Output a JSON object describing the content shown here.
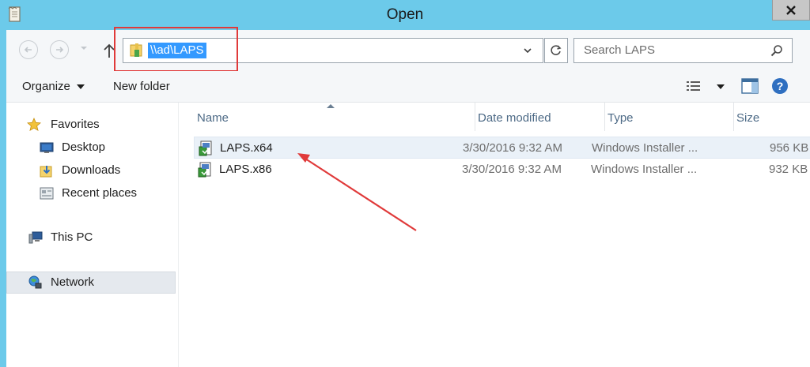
{
  "window": {
    "title": "Open",
    "close_label": "X"
  },
  "address_bar": {
    "path": "\\\\ad\\LAPS"
  },
  "search": {
    "placeholder": "Search LAPS"
  },
  "toolbar": {
    "organize_label": "Organize",
    "new_folder_label": "New folder"
  },
  "sidebar": {
    "items": [
      {
        "label": "Favorites",
        "icon": "star-icon"
      },
      {
        "label": "Desktop",
        "icon": "desktop-icon"
      },
      {
        "label": "Downloads",
        "icon": "downloads-icon"
      },
      {
        "label": "Recent places",
        "icon": "recent-places-icon"
      },
      {
        "label": "This PC",
        "icon": "computer-icon"
      },
      {
        "label": "Network",
        "icon": "network-icon",
        "selected": true
      }
    ]
  },
  "columns": {
    "name": "Name",
    "date": "Date modified",
    "type": "Type",
    "size": "Size"
  },
  "files": [
    {
      "name": "LAPS.x64",
      "date": "3/30/2016 9:32 AM",
      "type": "Windows Installer ...",
      "size": "956 KB"
    },
    {
      "name": "LAPS.x86",
      "date": "3/30/2016 9:32 AM",
      "type": "Windows Installer ...",
      "size": "932 KB"
    }
  ],
  "colors": {
    "titlebar": "#6ccaea",
    "selection": "#3399ff",
    "annotation": "#e03a3a"
  }
}
